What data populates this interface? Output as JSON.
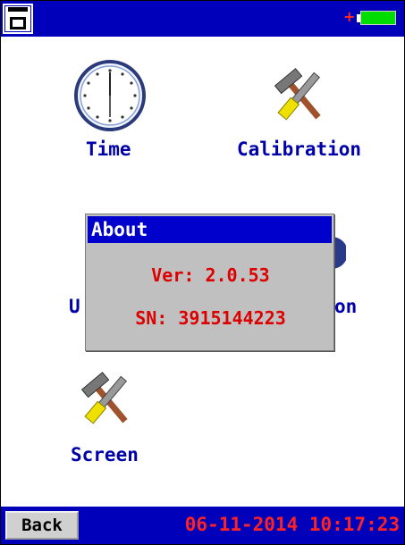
{
  "header": {
    "save_icon": "floppy-disk-icon",
    "battery_icon": "battery-icon",
    "battery_plus": "+",
    "battery_color": "#00dd00",
    "bar_color": "#0000bb"
  },
  "menu": {
    "items": [
      {
        "label": "Time",
        "icon": "clock-icon"
      },
      {
        "label": "Calibration",
        "icon": "tools-icon"
      },
      {
        "label": "U",
        "icon": "hidden-icon"
      },
      {
        "label": "on",
        "icon": "hidden-icon"
      },
      {
        "label": "Screen",
        "icon": "tools-icon"
      }
    ]
  },
  "dialog": {
    "title": "About",
    "version_line": "Ver: 2.0.53",
    "serial_line": "SN: 3915144223"
  },
  "footer": {
    "back_label": "Back",
    "datetime": "06-11-2014 10:17:23"
  }
}
